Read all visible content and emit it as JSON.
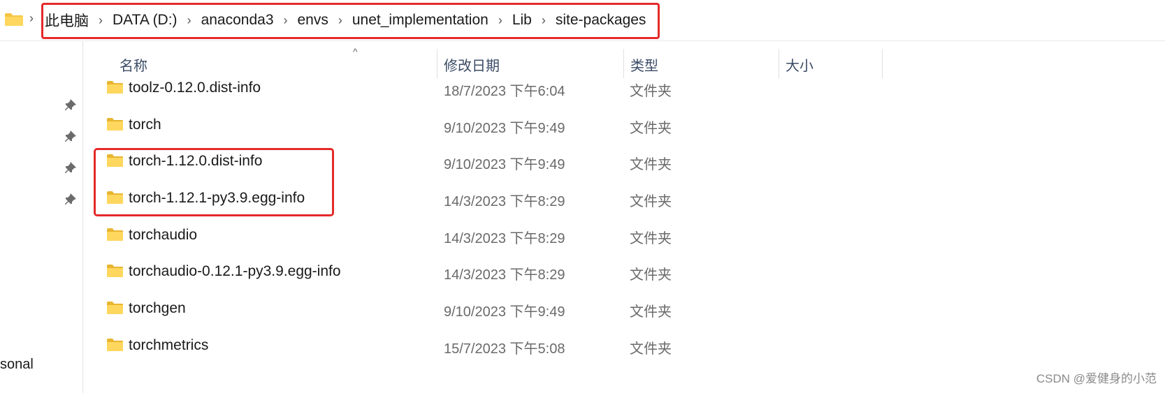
{
  "breadcrumb": {
    "items": [
      "此电脑",
      "DATA (D:)",
      "anaconda3",
      "envs",
      "unet_implementation",
      "Lib",
      "site-packages"
    ],
    "separator": "›"
  },
  "columns": {
    "name": "名称",
    "date": "修改日期",
    "type": "类型",
    "size": "大小"
  },
  "files": [
    {
      "name": "toolz-0.12.0.dist-info",
      "date": "18/7/2023 下午6:04",
      "type": "文件夹"
    },
    {
      "name": "torch",
      "date": "9/10/2023 下午9:49",
      "type": "文件夹"
    },
    {
      "name": "torch-1.12.0.dist-info",
      "date": "9/10/2023 下午9:49",
      "type": "文件夹"
    },
    {
      "name": "torch-1.12.1-py3.9.egg-info",
      "date": "14/3/2023 下午8:29",
      "type": "文件夹"
    },
    {
      "name": "torchaudio",
      "date": "14/3/2023 下午8:29",
      "type": "文件夹"
    },
    {
      "name": "torchaudio-0.12.1-py3.9.egg-info",
      "date": "14/3/2023 下午8:29",
      "type": "文件夹"
    },
    {
      "name": "torchgen",
      "date": "9/10/2023 下午9:49",
      "type": "文件夹"
    },
    {
      "name": "torchmetrics",
      "date": "15/7/2023 下午5:08",
      "type": "文件夹"
    }
  ],
  "nav": {
    "partial_label": "sonal"
  },
  "watermark": "CSDN @爱健身的小范",
  "colors": {
    "highlight": "#e52a2a",
    "folder": "#f4c542",
    "header_text": "#3b4c66"
  }
}
